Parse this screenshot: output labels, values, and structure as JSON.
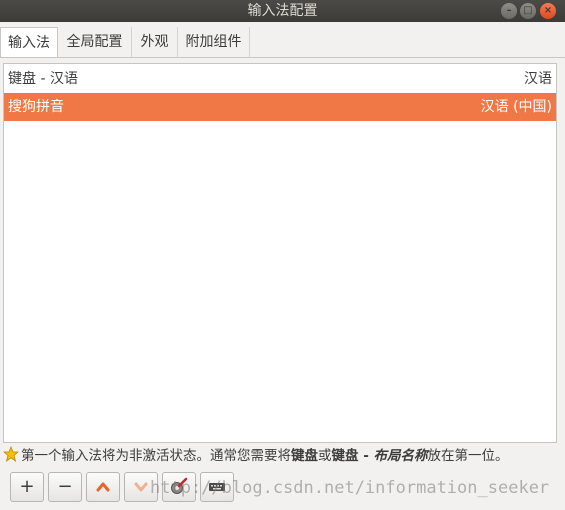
{
  "window": {
    "title": "输入法配置"
  },
  "tabs": [
    {
      "label": "输入法",
      "active": true
    },
    {
      "label": "全局配置",
      "active": false
    },
    {
      "label": "外观",
      "active": false
    },
    {
      "label": "附加组件",
      "active": false
    }
  ],
  "input_methods": [
    {
      "name": "键盘 - 汉语",
      "language": "汉语",
      "selected": false
    },
    {
      "name": "搜狗拼音",
      "language": "汉语 (中国)",
      "selected": true
    }
  ],
  "hint": {
    "prefix": "第一个输入法将为非激活状态。通常您需要将",
    "bold1": "键盘",
    "mid": "或",
    "bold2": "键盘 - ",
    "bold_italic": "布局名称",
    "suffix": "放在第一位。"
  },
  "toolbar": {
    "add": "+",
    "remove": "−",
    "move_up_icon": "chevron-up-icon",
    "move_down_icon": "chevron-down-icon",
    "configure_icon": "configure-icon",
    "keyboard_icon": "keyboard-icon"
  },
  "watermark": "http://blog.csdn.net/information_seeker",
  "colors": {
    "selection": "#f07746",
    "close_button": "#e0491c"
  }
}
